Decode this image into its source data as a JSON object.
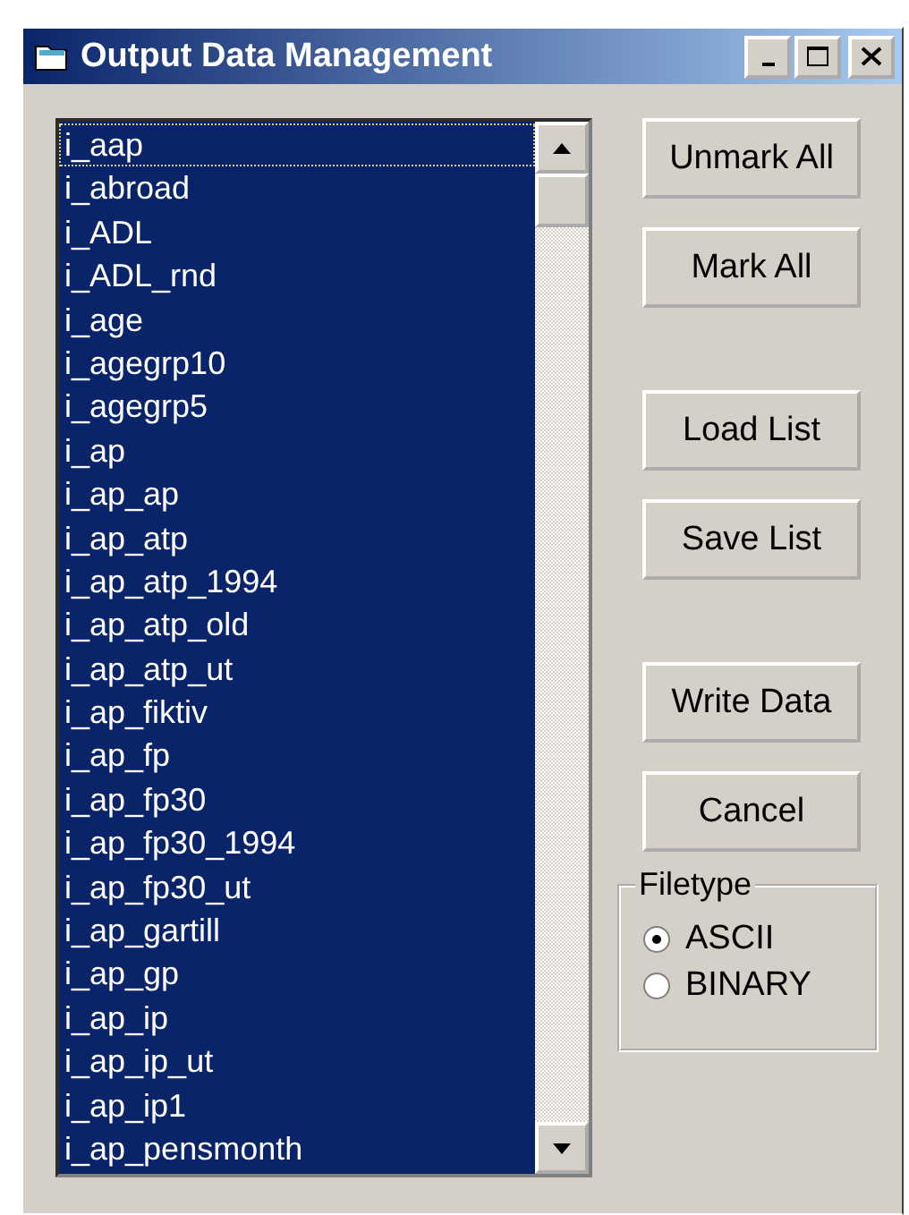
{
  "window": {
    "title": "Output Data Management"
  },
  "variables": [
    {
      "label": "i_aap",
      "selected": true,
      "focused": true
    },
    {
      "label": "i_abroad",
      "selected": true,
      "focused": false
    },
    {
      "label": "i_ADL",
      "selected": true,
      "focused": false
    },
    {
      "label": "i_ADL_rnd",
      "selected": true,
      "focused": false
    },
    {
      "label": "i_age",
      "selected": true,
      "focused": false
    },
    {
      "label": "i_agegrp10",
      "selected": true,
      "focused": false
    },
    {
      "label": "i_agegrp5",
      "selected": true,
      "focused": false
    },
    {
      "label": "i_ap",
      "selected": true,
      "focused": false
    },
    {
      "label": "i_ap_ap",
      "selected": true,
      "focused": false
    },
    {
      "label": "i_ap_atp",
      "selected": true,
      "focused": false
    },
    {
      "label": "i_ap_atp_1994",
      "selected": true,
      "focused": false
    },
    {
      "label": "i_ap_atp_old",
      "selected": true,
      "focused": false
    },
    {
      "label": "i_ap_atp_ut",
      "selected": true,
      "focused": false
    },
    {
      "label": "i_ap_fiktiv",
      "selected": true,
      "focused": false
    },
    {
      "label": "i_ap_fp",
      "selected": true,
      "focused": false
    },
    {
      "label": "i_ap_fp30",
      "selected": true,
      "focused": false
    },
    {
      "label": "i_ap_fp30_1994",
      "selected": true,
      "focused": false
    },
    {
      "label": "i_ap_fp30_ut",
      "selected": true,
      "focused": false
    },
    {
      "label": "i_ap_gartill",
      "selected": true,
      "focused": false
    },
    {
      "label": "i_ap_gp",
      "selected": true,
      "focused": false
    },
    {
      "label": "i_ap_ip",
      "selected": true,
      "focused": false
    },
    {
      "label": "i_ap_ip_ut",
      "selected": true,
      "focused": false
    },
    {
      "label": "i_ap_ip1",
      "selected": true,
      "focused": false
    },
    {
      "label": "i_ap_pensmonth",
      "selected": true,
      "focused": false
    }
  ],
  "button_groups": [
    [
      "Unmark All",
      "Mark All"
    ],
    [
      "Load List",
      "Save List"
    ],
    [
      "Write Data",
      "Cancel"
    ]
  ],
  "filetype": {
    "title": "Filetype",
    "options": [
      {
        "label": "ASCII",
        "selected": true
      },
      {
        "label": "BINARY",
        "selected": false
      }
    ]
  }
}
